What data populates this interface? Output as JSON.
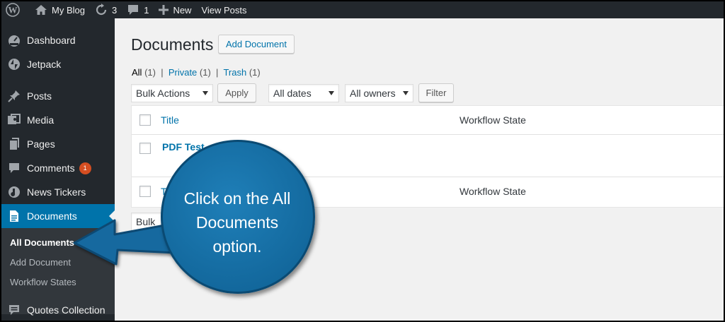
{
  "adminbar": {
    "site_name": "My Blog",
    "updates_count": "3",
    "comments_count": "1",
    "new_label": "New",
    "view_posts_label": "View Posts"
  },
  "sidebar": {
    "items": [
      {
        "label": "Dashboard",
        "icon": "dashboard-icon"
      },
      {
        "label": "Jetpack",
        "icon": "jetpack-icon"
      },
      {
        "label": "Posts",
        "icon": "pin-icon"
      },
      {
        "label": "Media",
        "icon": "media-icon"
      },
      {
        "label": "Pages",
        "icon": "pages-icon"
      },
      {
        "label": "Comments",
        "icon": "comments-icon",
        "badge": "1"
      },
      {
        "label": "News Tickers",
        "icon": "news-tickers-icon"
      },
      {
        "label": "Documents",
        "icon": "document-icon",
        "active": true
      },
      {
        "label": "Quotes Collection",
        "icon": "quotes-icon"
      }
    ],
    "submenu": [
      {
        "label": "All Documents",
        "current": true
      },
      {
        "label": "Add Document"
      },
      {
        "label": "Workflow States"
      }
    ]
  },
  "main": {
    "title": "Documents",
    "add_button": "Add Document",
    "views": {
      "all_label": "All",
      "all_count": "(1)",
      "private_label": "Private",
      "private_count": "(1)",
      "trash_label": "Trash",
      "trash_count": "(1)"
    },
    "filters": {
      "bulk_actions": "Bulk Actions",
      "apply": "Apply",
      "dates": "All dates",
      "owners": "All owners",
      "filter": "Filter"
    },
    "table": {
      "col_title": "Title",
      "col_state": "Workflow State",
      "row_title": "PDF Test",
      "footer_title_partial": "T",
      "footer_state": "Workflow State"
    },
    "bulk_bottom_partial": "Bulk"
  },
  "callout": {
    "text": "Click on the All Documents option."
  },
  "colors": {
    "adminbar_bg": "#23282d",
    "active_menu": "#0073aa",
    "link": "#0073aa",
    "callout": "#16699f",
    "badge": "#d54e21"
  }
}
